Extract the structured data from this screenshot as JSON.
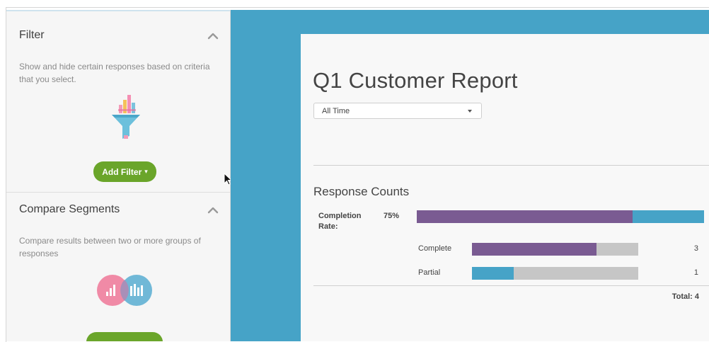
{
  "filter": {
    "title": "Filter",
    "description": "Show and hide certain responses based on criteria that you select.",
    "button_label": "Add Filter",
    "button_caret": "▾"
  },
  "compare": {
    "title": "Compare Segments",
    "description": "Compare results between two or more groups of responses"
  },
  "report": {
    "title": "Q1 Customer Report",
    "date_range": {
      "selected": "All Time"
    },
    "section_title": "Response Counts",
    "completion": {
      "label": "Completion Rate:",
      "value_text": "75%",
      "value": 0.75
    },
    "rows": [
      {
        "label": "Complete",
        "count": "3",
        "fraction": 0.75,
        "color": "#7a5b92"
      },
      {
        "label": "Partial",
        "count": "1",
        "fraction": 0.25,
        "color": "#46a3c7"
      }
    ],
    "total": "Total: 4"
  },
  "colors": {
    "accent_green": "#6aa52a",
    "purple": "#7a5b92",
    "blue": "#46a3c7",
    "backdrop": "#46a3c7"
  },
  "icons": [
    "chevron-up-icon",
    "funnel-chart-icon",
    "segments-venn-icon",
    "caret-down-icon",
    "mouse-cursor-icon"
  ]
}
